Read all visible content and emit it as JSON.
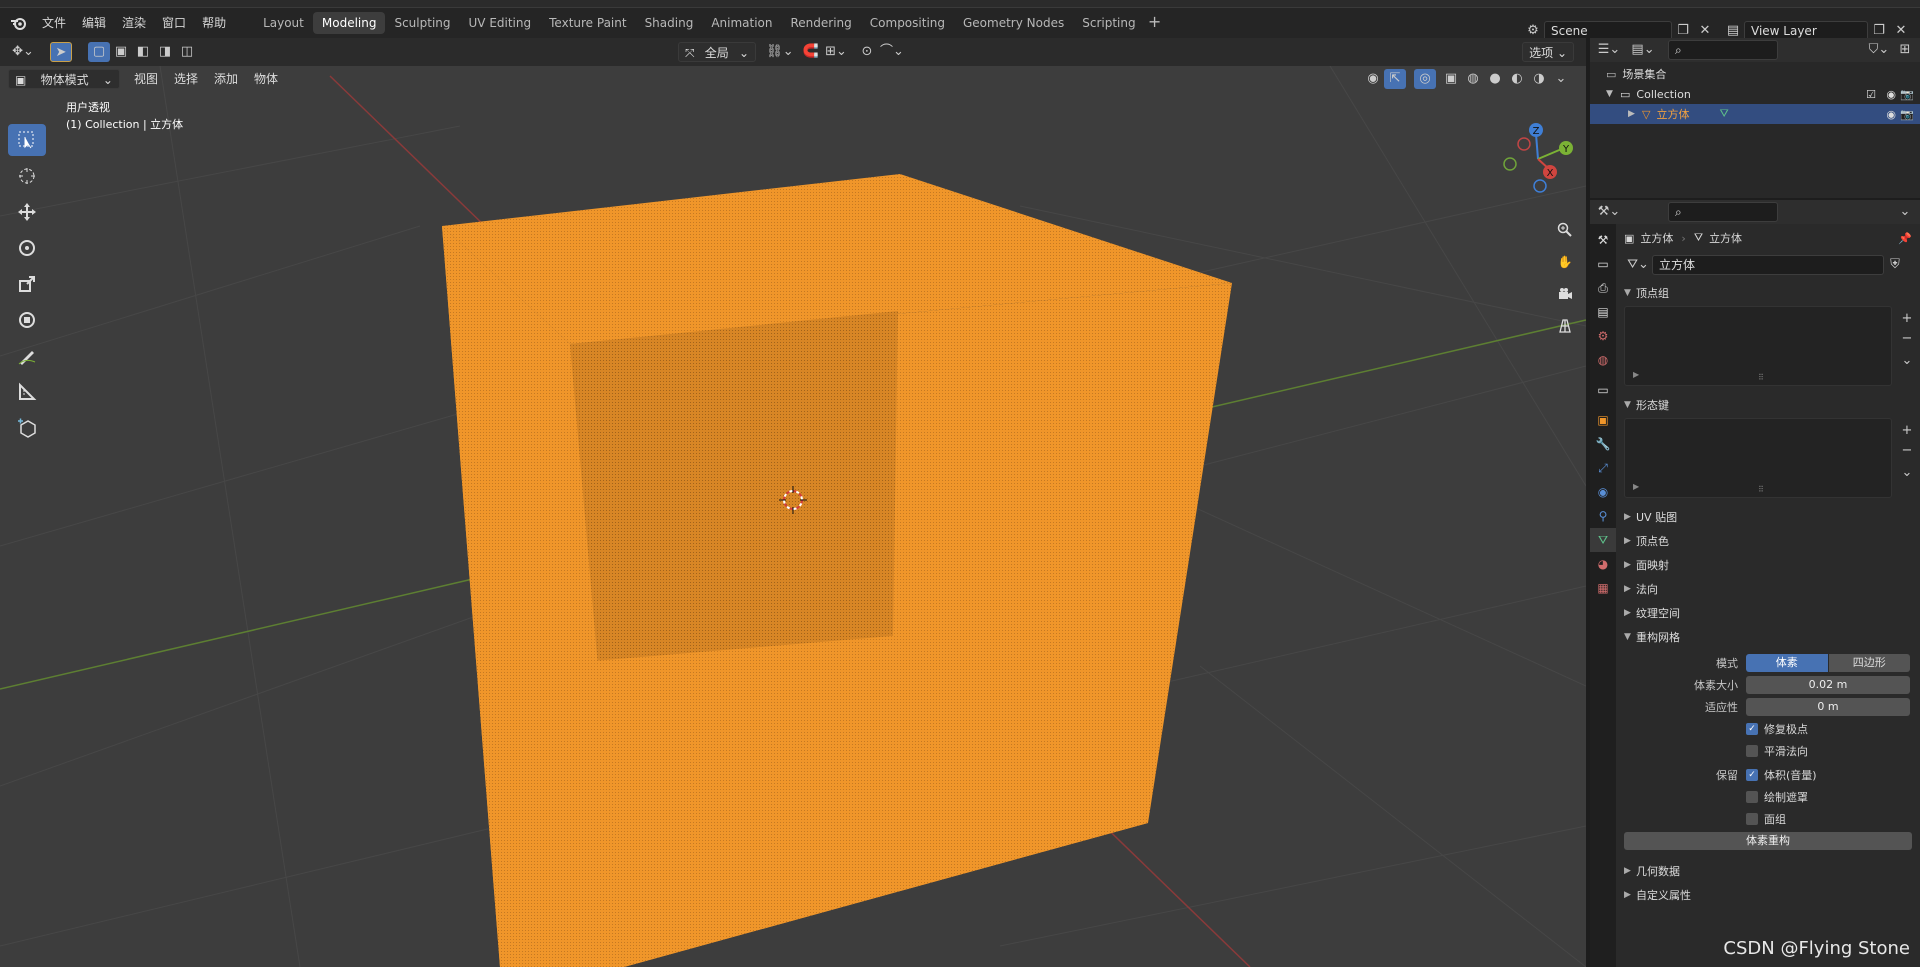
{
  "menubar": {
    "items": [
      "文件",
      "编辑",
      "渲染",
      "窗口",
      "帮助"
    ],
    "workspaces": [
      "Layout",
      "Modeling",
      "Sculpting",
      "UV Editing",
      "Texture Paint",
      "Shading",
      "Animation",
      "Rendering",
      "Compositing",
      "Geometry Nodes",
      "Scripting"
    ],
    "active_workspace": "Modeling",
    "scene_name": "Scene",
    "view_layer": "View Layer"
  },
  "viewport_header": {
    "orientation": "全局",
    "options_label": "选项",
    "mode": "物体模式",
    "menus": [
      "视图",
      "选择",
      "添加",
      "物体"
    ]
  },
  "viewport": {
    "view_name": "用户透视",
    "object_info": "(1) Collection | 立方体",
    "gizmo": {
      "x_label": "X",
      "y_label": "Y",
      "z_label": "Z"
    },
    "colors": {
      "background": "#3d3d3d",
      "cube": "#f0962a",
      "x_axis": "#c04545",
      "y_axis": "#6fa33a"
    }
  },
  "outliner": {
    "root": "场景集合",
    "collection": "Collection",
    "object": "立方体"
  },
  "properties": {
    "breadcrumb_object": "立方体",
    "breadcrumb_mesh": "立方体",
    "mesh_name": "立方体",
    "panels": {
      "vertex_groups": "顶点组",
      "shape_keys": "形态键",
      "uv_maps": "UV 贴图",
      "vertex_colors": "顶点色",
      "face_maps": "面映射",
      "normals": "法向",
      "texture_space": "纹理空间",
      "remesh": "重构网格",
      "geometry_data": "几何数据",
      "custom_props": "自定义属性"
    },
    "remesh": {
      "mode_label": "模式",
      "mode_options": [
        "体素",
        "四边形"
      ],
      "mode_selected": "体素",
      "voxel_size_label": "体素大小",
      "voxel_size": "0.02 m",
      "adaptivity_label": "适应性",
      "adaptivity": "0 m",
      "fix_poles": "修复极点",
      "fix_poles_checked": true,
      "smooth_normals": "平滑法向",
      "smooth_normals_checked": false,
      "preserve_label": "保留",
      "volume": "体积(音量)",
      "volume_checked": true,
      "paint_mask": "绘制遮罩",
      "paint_mask_checked": false,
      "face_sets": "面组",
      "face_sets_checked": false,
      "apply_button": "体素重构"
    }
  },
  "watermark": "CSDN @Flying Stone"
}
